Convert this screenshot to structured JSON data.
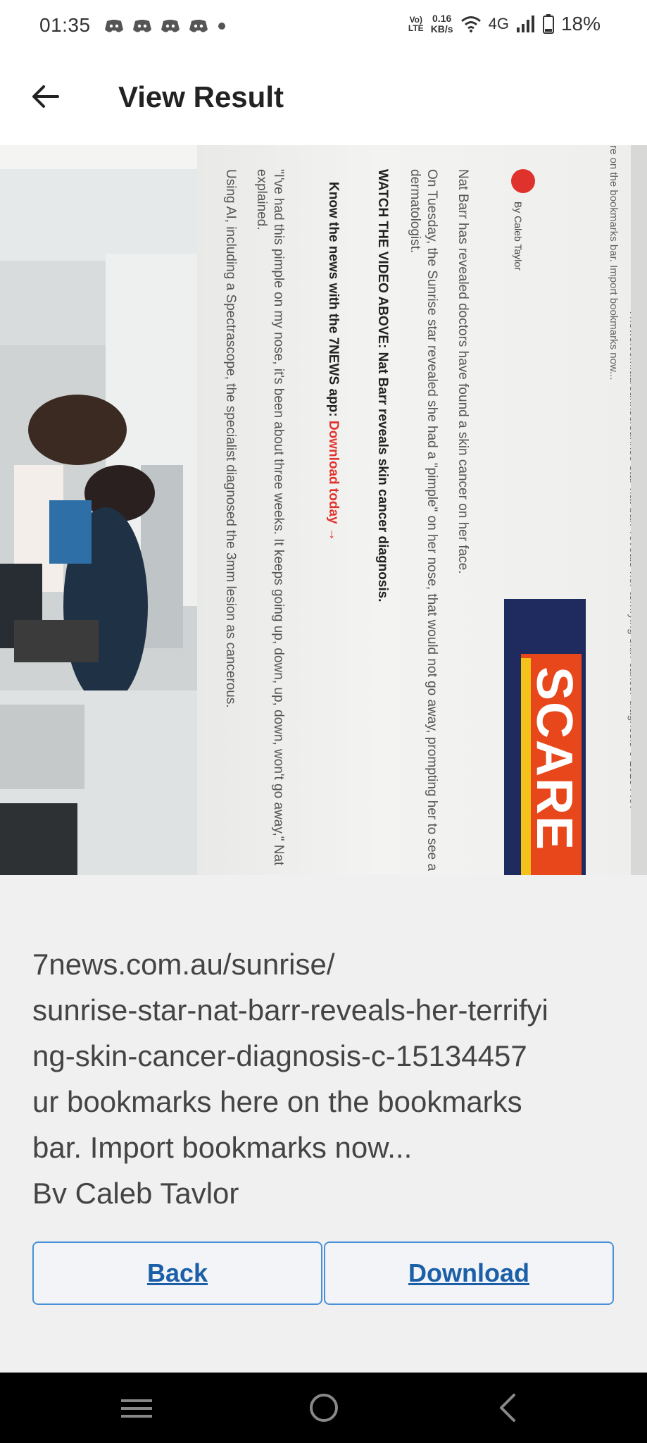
{
  "status_bar": {
    "time": "01:35",
    "notification_icons": [
      "discord-icon",
      "discord-icon",
      "discord-icon",
      "discord-icon"
    ],
    "volte": [
      "Vo)",
      "LTE"
    ],
    "net_speed": [
      "0.16",
      "KB/s"
    ],
    "network_type": "4G",
    "battery": "18%"
  },
  "app_bar": {
    "title": "View Result"
  },
  "photo": {
    "url_line": "7news.com.au/sunrise/sunrise-star-nat-barr-reveals-her-terrifying-skin-cancer-diagnosis-c-15134457",
    "bookmarks_line": "re on the bookmarks bar. Import bookmarks now...",
    "byline": "By Caleb Taylor",
    "para1": "Nat Barr has revealed doctors have found a skin cancer on her face.",
    "para2a": "On Tuesday, the Sunrise star revealed she had a \"pimple\" on her nose, that would not go away, prompting her to see a",
    "para2b": "dermatologist.",
    "watch": "WATCH THE VIDEO ABOVE: Nat Barr reveals skin cancer diagnosis.",
    "know_prefix": "Know the news with the 7NEWS app: ",
    "know_link": "Download today →",
    "quote_a": "\"I've had this pimple on my nose, it's been about three weeks. It keeps going up, down, up, down, won't go away,\" Nat",
    "quote_b": "explained.",
    "para3": "Using AI, including a Spectrascope, the specialist diagnosed the 3mm lesion as cancerous.",
    "banner": "SCARE"
  },
  "result": {
    "lines": [
      "7news.com.au/sunrise/",
      "sunrise-star-nat-barr-reveals-her-terrifyi",
      "ng-skin-cancer-diagnosis-c-15134457",
      "ur bookmarks here on the bookmarks",
      "bar. Import bookmarks now...",
      "Bv Caleb Tavlor"
    ]
  },
  "buttons": {
    "back": "Back",
    "download": "Download"
  },
  "colors": {
    "accent": "#4a90d9",
    "link": "#1a5fa8",
    "brand_red": "#e0322c"
  }
}
